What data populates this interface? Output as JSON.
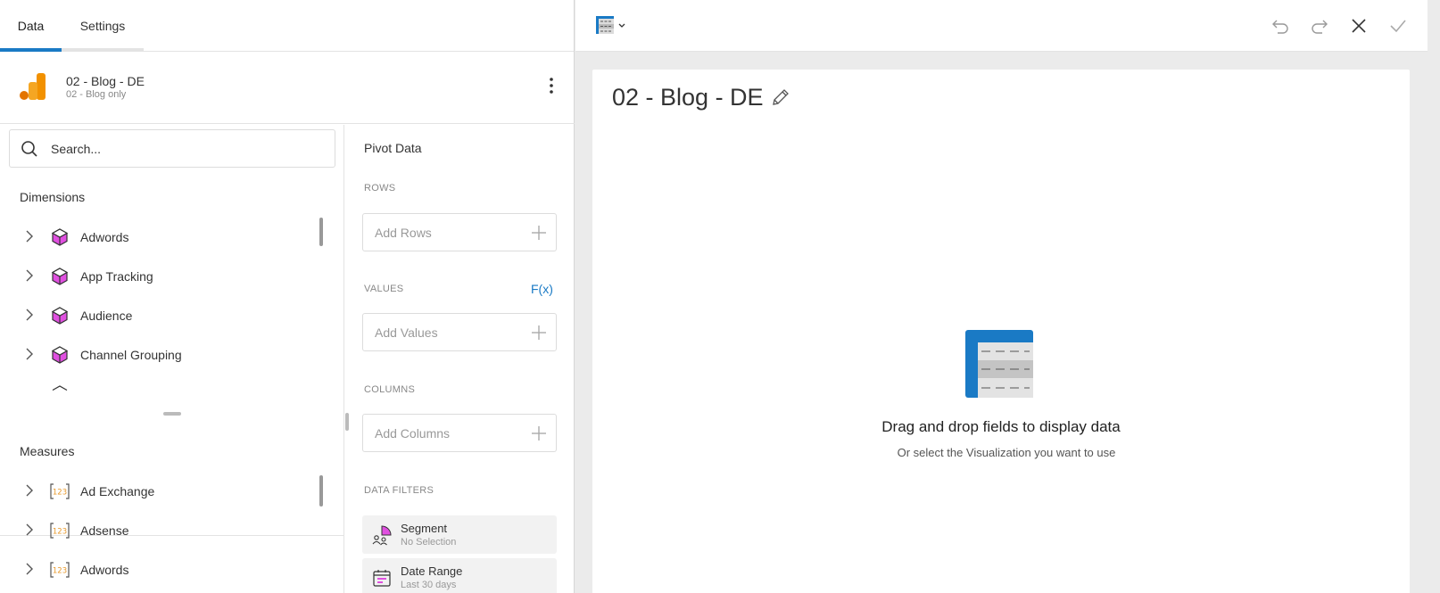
{
  "tabs": {
    "data": "Data",
    "settings": "Settings"
  },
  "source": {
    "name": "02 - Blog - DE",
    "subtitle": "02 - Blog only"
  },
  "search": {
    "placeholder": "Search..."
  },
  "dimensions": {
    "title": "Dimensions",
    "items": [
      {
        "label": "Adwords"
      },
      {
        "label": "App Tracking"
      },
      {
        "label": "Audience"
      },
      {
        "label": "Channel Grouping"
      }
    ]
  },
  "measures": {
    "title": "Measures",
    "items": [
      {
        "label": "Ad Exchange"
      },
      {
        "label": "Adsense"
      },
      {
        "label": "Adwords"
      }
    ]
  },
  "pivot": {
    "title": "Pivot Data",
    "rows_label": "ROWS",
    "rows_placeholder": "Add Rows",
    "values_label": "VALUES",
    "fx_label": "F(x)",
    "values_placeholder": "Add Values",
    "columns_label": "COLUMNS",
    "columns_placeholder": "Add Columns",
    "filters_label": "DATA FILTERS",
    "filters": [
      {
        "name": "Segment",
        "value": "No Selection"
      },
      {
        "name": "Date Range",
        "value": "Last 30 days"
      }
    ]
  },
  "canvas": {
    "title": "02 - Blog - DE",
    "empty_title": "Drag and drop fields to display data",
    "empty_subtitle": "Or select the Visualization you want to use"
  },
  "colors": {
    "accent": "#1a7ac5",
    "dimension_icon": "#d63cd6",
    "measure_icon": "#e89a2c",
    "analytics_orange": "#f5a623"
  }
}
